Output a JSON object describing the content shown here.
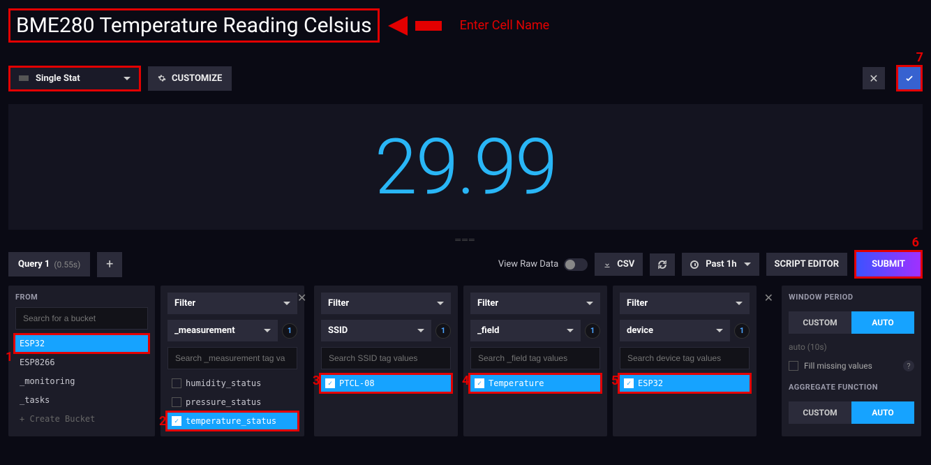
{
  "cell_name": "BME280 Temperature Reading Celsius",
  "hint_label": "Enter Cell Name",
  "viz_type": "Single Stat",
  "customize_label": "CUSTOMIZE",
  "stat_value": "29.99",
  "query_tab": {
    "label": "Query 1",
    "time": "(0.55s)"
  },
  "view_raw_label": "View Raw Data",
  "csv_label": "CSV",
  "time_range": "Past 1h",
  "script_editor_label": "SCRIPT EDITOR",
  "submit_label": "SUBMIT",
  "from": {
    "header": "FROM",
    "search_placeholder": "Search for a bucket",
    "buckets": [
      "ESP32",
      "ESP8266",
      "_monitoring",
      "_tasks"
    ],
    "create_label": "+ Create Bucket"
  },
  "filter_label": "Filter",
  "filters": [
    {
      "key": "_measurement",
      "search_placeholder": "Search _measurement tag va",
      "options": [
        "humidity_status",
        "pressure_status",
        "temperature_status"
      ],
      "selected": "temperature_status"
    },
    {
      "key": "SSID",
      "search_placeholder": "Search SSID tag values",
      "options": [
        "PTCL-08"
      ],
      "selected": "PTCL-08"
    },
    {
      "key": "_field",
      "search_placeholder": "Search _field tag values",
      "options": [
        "Temperature"
      ],
      "selected": "Temperature"
    },
    {
      "key": "device",
      "search_placeholder": "Search device tag values",
      "options": [
        "ESP32"
      ],
      "selected": "ESP32"
    }
  ],
  "count_badge": "1",
  "window_period": {
    "header": "WINDOW PERIOD",
    "custom": "CUSTOM",
    "auto": "AUTO",
    "auto_value": "auto (10s)",
    "fill_label": "Fill missing values"
  },
  "aggregate": {
    "header": "AGGREGATE FUNCTION",
    "custom": "CUSTOM",
    "auto": "AUTO"
  },
  "annotations": {
    "n1": "1",
    "n2": "2",
    "n3": "3",
    "n4": "4",
    "n5": "5",
    "n6": "6",
    "n7": "7"
  }
}
